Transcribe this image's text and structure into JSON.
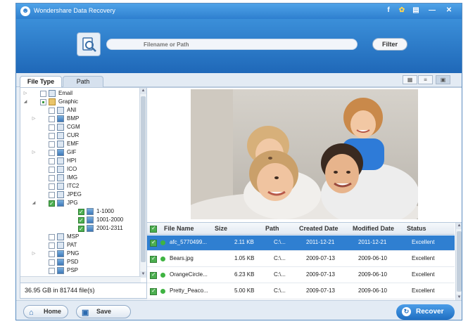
{
  "window": {
    "title": "Wondershare Data Recovery",
    "controls": [
      "f",
      "✿",
      "▤",
      "—",
      "✕"
    ]
  },
  "search": {
    "placeholder": "Filename or Path",
    "filter_label": "Filter",
    "icon": "search-file-icon"
  },
  "tabs": [
    {
      "label": "File Type",
      "active": true
    },
    {
      "label": "Path",
      "active": false
    }
  ],
  "view_buttons": [
    "thumbnail-view-icon",
    "list-view-icon",
    "preview-view-icon"
  ],
  "tree": [
    {
      "label": "Email",
      "level": 0,
      "expander": "▷",
      "checkbox": "none",
      "icon": "email"
    },
    {
      "label": "Graphic",
      "level": 0,
      "expander": "◢",
      "checkbox": "partial",
      "icon": "folder"
    },
    {
      "label": "ANI",
      "level": 1,
      "expander": "",
      "checkbox": "none",
      "icon": "file"
    },
    {
      "label": "BMP",
      "level": 1,
      "expander": "▷",
      "checkbox": "none",
      "icon": "img"
    },
    {
      "label": "CGM",
      "level": 1,
      "expander": "",
      "checkbox": "none",
      "icon": "file"
    },
    {
      "label": "CUR",
      "level": 1,
      "expander": "",
      "checkbox": "none",
      "icon": "file"
    },
    {
      "label": "EMF",
      "level": 1,
      "expander": "",
      "checkbox": "none",
      "icon": "file"
    },
    {
      "label": "GIF",
      "level": 1,
      "expander": "▷",
      "checkbox": "none",
      "icon": "img"
    },
    {
      "label": "HPI",
      "level": 1,
      "expander": "",
      "checkbox": "none",
      "icon": "file"
    },
    {
      "label": "ICO",
      "level": 1,
      "expander": "",
      "checkbox": "none",
      "icon": "file"
    },
    {
      "label": "IMG",
      "level": 1,
      "expander": "",
      "checkbox": "none",
      "icon": "file"
    },
    {
      "label": "ITC2",
      "level": 1,
      "expander": "",
      "checkbox": "none",
      "icon": "file"
    },
    {
      "label": "JPEG",
      "level": 1,
      "expander": "",
      "checkbox": "none",
      "icon": "file"
    },
    {
      "label": "JPG",
      "level": 1,
      "expander": "◢",
      "checkbox": "checked",
      "icon": "img"
    },
    {
      "label": "1-1000",
      "level": 2,
      "expander": "",
      "checkbox": "checked",
      "icon": "img"
    },
    {
      "label": "1001-2000",
      "level": 2,
      "expander": "",
      "checkbox": "checked",
      "icon": "img"
    },
    {
      "label": "2001-2311",
      "level": 2,
      "expander": "",
      "checkbox": "checked",
      "icon": "img"
    },
    {
      "label": "MSP",
      "level": 1,
      "expander": "",
      "checkbox": "none",
      "icon": "file"
    },
    {
      "label": "PAT",
      "level": 1,
      "expander": "",
      "checkbox": "none",
      "icon": "file"
    },
    {
      "label": "PNG",
      "level": 1,
      "expander": "▷",
      "checkbox": "none",
      "icon": "img"
    },
    {
      "label": "PSD",
      "level": 1,
      "expander": "",
      "checkbox": "none",
      "icon": "img"
    },
    {
      "label": "PSP",
      "level": 1,
      "expander": "",
      "checkbox": "none",
      "icon": "img"
    }
  ],
  "summary": "36.95 GB in 81744 file(s)",
  "table": {
    "columns": [
      "File Name",
      "Size",
      "Path",
      "Created Date",
      "Modified Date",
      "Status"
    ],
    "rows": [
      {
        "name": "afc_5770499...",
        "size": "2.11 KB",
        "path": "C:\\...",
        "created": "2011-12-21",
        "modified": "2011-12-21",
        "status": "Excellent",
        "selected": true
      },
      {
        "name": "Bears.jpg",
        "size": "1.05 KB",
        "path": "C:\\...",
        "created": "2009-07-13",
        "modified": "2009-06-10",
        "status": "Excellent",
        "selected": false
      },
      {
        "name": "OrangeCircle...",
        "size": "6.23 KB",
        "path": "C:\\...",
        "created": "2009-07-13",
        "modified": "2009-06-10",
        "status": "Excellent",
        "selected": false
      },
      {
        "name": "Pretty_Peaco...",
        "size": "5.00 KB",
        "path": "C:\\...",
        "created": "2009-07-13",
        "modified": "2009-06-10",
        "status": "Excellent",
        "selected": false
      }
    ]
  },
  "buttons": {
    "home": "Home",
    "save": "Save",
    "recover": "Recover"
  },
  "colors": {
    "accent": "#2e7fcf",
    "selected_row": "#2f7fd1",
    "check_green": "#4caf50"
  }
}
